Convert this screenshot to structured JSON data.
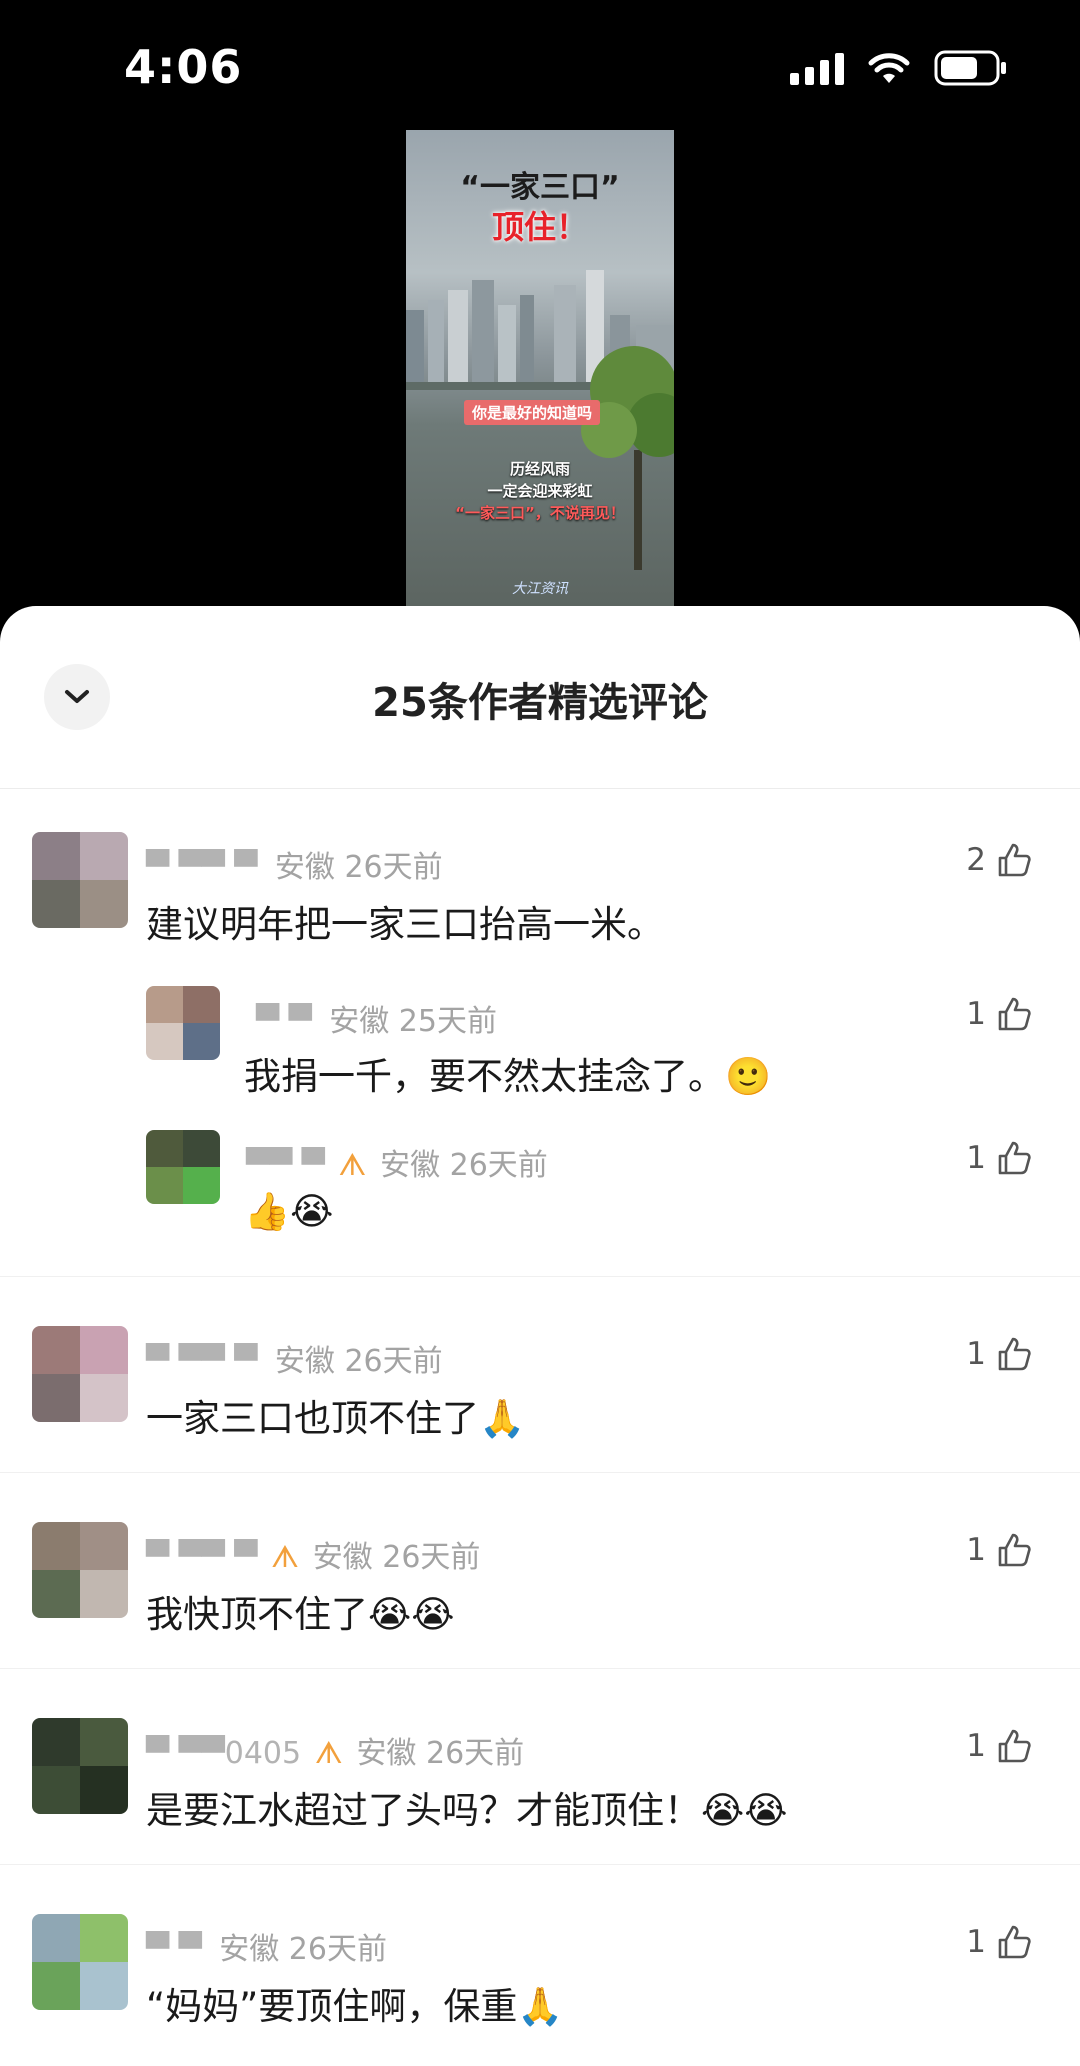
{
  "status_bar": {
    "time": "4:06"
  },
  "video": {
    "title_line1": "“一家三口”",
    "title_line2": "顶住！",
    "mid_caption": "你是最好的知道吗",
    "caption_line1": "历经风雨",
    "caption_line2": "一定会迎来彩虹",
    "caption_line3": "“一家三口”，不说再见！",
    "logo": "大江资讯"
  },
  "panel": {
    "title": "25条作者精选评论"
  },
  "comments": [
    {
      "user": "▀ ▀▀ ▀",
      "badge": "",
      "location": "安徽",
      "time": "26天前",
      "text": "建议明年把一家三口抬高一米。",
      "likes": "2",
      "reply": false
    },
    {
      "user": "▀ ▀",
      "badge": "",
      "location": "安徽",
      "time": "25天前",
      "text": "我捐一千，要不然太挂念了。🙂",
      "likes": "1",
      "reply": true
    },
    {
      "user": "▀▀ ▀",
      "badge": "ᗑ",
      "location": "安徽",
      "time": "26天前",
      "text": "👍😭",
      "likes": "1",
      "reply": true
    },
    {
      "user": "▀ ▀▀ ▀",
      "badge": "",
      "location": "安徽",
      "time": "26天前",
      "text": "一家三口也顶不住了🙏",
      "likes": "1",
      "reply": false
    },
    {
      "user": "▀ ▀▀ ▀",
      "badge": "ᗑ",
      "location": "安徽",
      "time": "26天前",
      "text": "我快顶不住了😭😭",
      "likes": "1",
      "reply": false
    },
    {
      "user": "▀ ▀▀0405",
      "badge": "ᗑ",
      "location": "安徽",
      "time": "26天前",
      "text": "是要江水超过了头吗？才能顶住！😭😭",
      "likes": "1",
      "reply": false
    },
    {
      "user": "▀ ▀",
      "badge": "",
      "location": "安徽",
      "time": "26天前",
      "text": "“妈妈”要顶住啊，保重🙏",
      "likes": "1",
      "reply": false
    }
  ]
}
